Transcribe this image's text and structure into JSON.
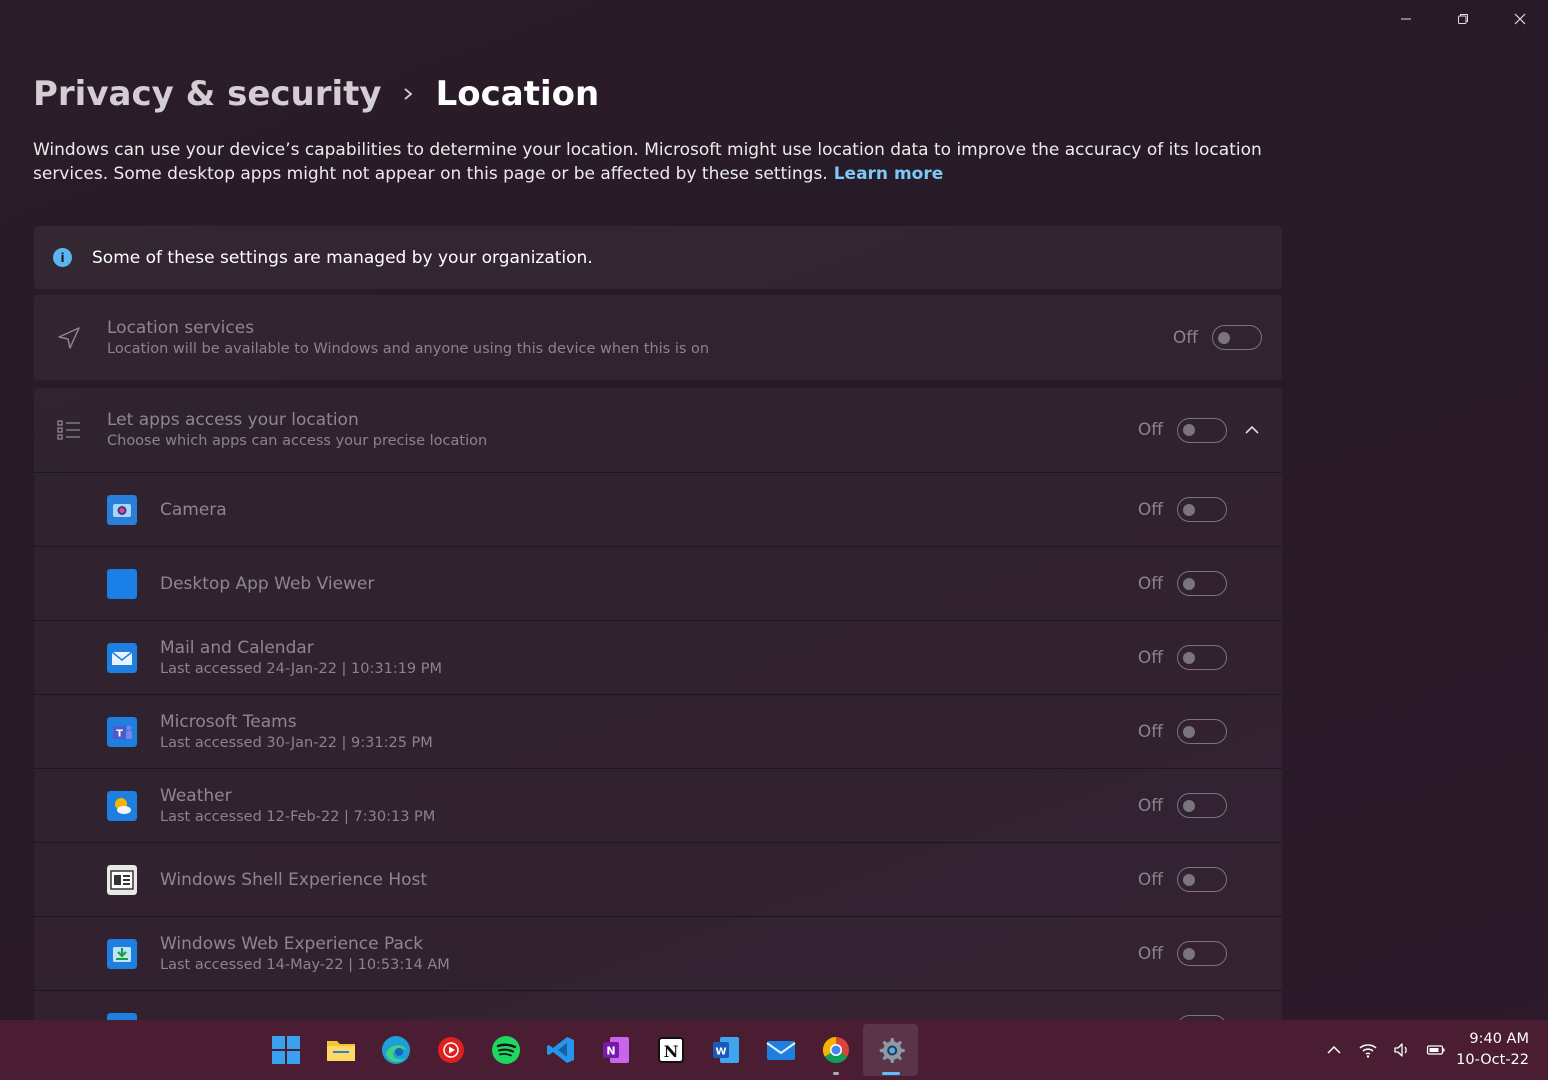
{
  "window": {
    "minimize_icon": "minimize-icon",
    "restore_icon": "restore-icon",
    "close_icon": "close-icon"
  },
  "breadcrumb": {
    "parent": "Privacy & security",
    "current": "Location"
  },
  "description": {
    "text": "Windows can use your device’s capabilities to determine your location. Microsoft might use location data to improve the accuracy of its location services. Some desktop apps might not appear on this page or be affected by these settings.",
    "link": "Learn more"
  },
  "info_banner": {
    "text": "Some of these settings are managed by your organization."
  },
  "location_services": {
    "title": "Location services",
    "subtitle": "Location will be available to Windows and anyone using this device when this is on",
    "state": "Off"
  },
  "apps_access": {
    "title": "Let apps access your location",
    "subtitle": "Choose which apps can access your precise location",
    "state": "Off",
    "apps": [
      {
        "name": "Camera",
        "detail": "",
        "state": "Off"
      },
      {
        "name": "Desktop App Web Viewer",
        "detail": "",
        "state": "Off"
      },
      {
        "name": "Mail and Calendar",
        "detail": "Last accessed 24-Jan-22  |  10:31:19 PM",
        "state": "Off"
      },
      {
        "name": "Microsoft Teams",
        "detail": "Last accessed 30-Jan-22  |  9:31:25 PM",
        "state": "Off"
      },
      {
        "name": "Weather",
        "detail": "Last accessed 12-Feb-22  |  7:30:13 PM",
        "state": "Off"
      },
      {
        "name": "Windows Shell Experience Host",
        "detail": "",
        "state": "Off"
      },
      {
        "name": "Windows Web Experience Pack",
        "detail": "Last accessed 14-May-22  |  10:53:14 AM",
        "state": "Off"
      }
    ]
  },
  "taskbar": {
    "apps": [
      "start",
      "file-explorer",
      "edge",
      "youtube-music",
      "spotify",
      "vscode",
      "onenote",
      "notion",
      "word",
      "mail",
      "chrome",
      "settings"
    ]
  },
  "clock": {
    "time": "9:40 AM",
    "date": "10-Oct-22"
  },
  "colors": {
    "accent": "#5bc0f5",
    "link": "#7dc8f5",
    "taskbar": "#4a1d33"
  }
}
